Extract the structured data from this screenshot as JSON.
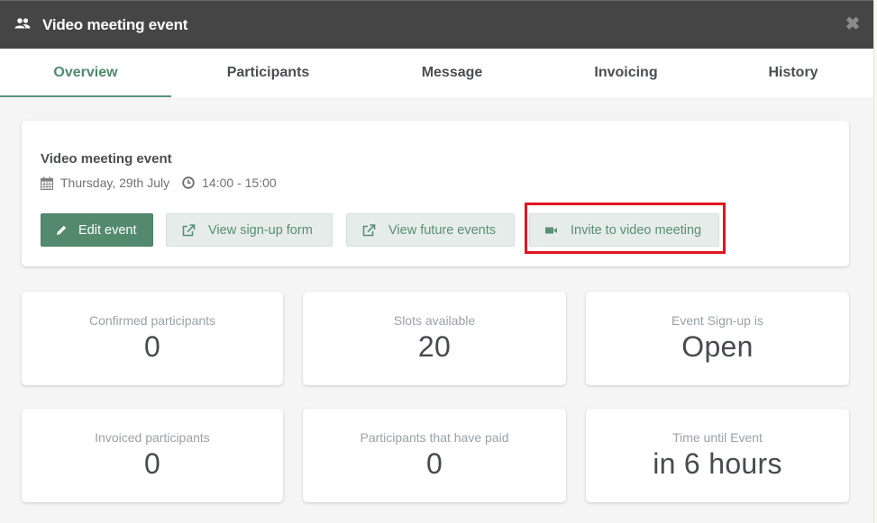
{
  "modal": {
    "title": "Video meeting event",
    "header_icon": "people-icon",
    "close_icon": "close-icon"
  },
  "tabs": [
    {
      "label": "Overview",
      "active": true
    },
    {
      "label": "Participants",
      "active": false
    },
    {
      "label": "Message",
      "active": false
    },
    {
      "label": "Invoicing",
      "active": false
    },
    {
      "label": "History",
      "active": false
    }
  ],
  "event": {
    "title": "Video meeting event",
    "date": "Thursday, 29th July",
    "time": "14:00 - 15:00",
    "date_icon": "calendar-icon",
    "time_icon": "clock-icon"
  },
  "actions": {
    "edit": {
      "label": "Edit event",
      "icon": "pencil-icon"
    },
    "signup_form": {
      "label": "View sign-up form",
      "icon": "external-link-icon"
    },
    "future_events": {
      "label": "View future events",
      "icon": "external-link-icon"
    },
    "video_invite": {
      "label": "Invite to video meeting",
      "icon": "video-camera-icon",
      "highlighted": true
    }
  },
  "stats": [
    {
      "label": "Confirmed participants",
      "value": "0"
    },
    {
      "label": "Slots available",
      "value": "20"
    },
    {
      "label": "Event Sign-up is",
      "value": "Open"
    },
    {
      "label": "Invoiced participants",
      "value": "0"
    },
    {
      "label": "Participants that have paid",
      "value": "0"
    },
    {
      "label": "Time until Event",
      "value": "in 6 hours"
    }
  ],
  "colors": {
    "header_bg": "#454545",
    "accent": "#538a6e",
    "secondary_button_bg": "#e6ecea",
    "highlight_border": "#e0141e"
  }
}
